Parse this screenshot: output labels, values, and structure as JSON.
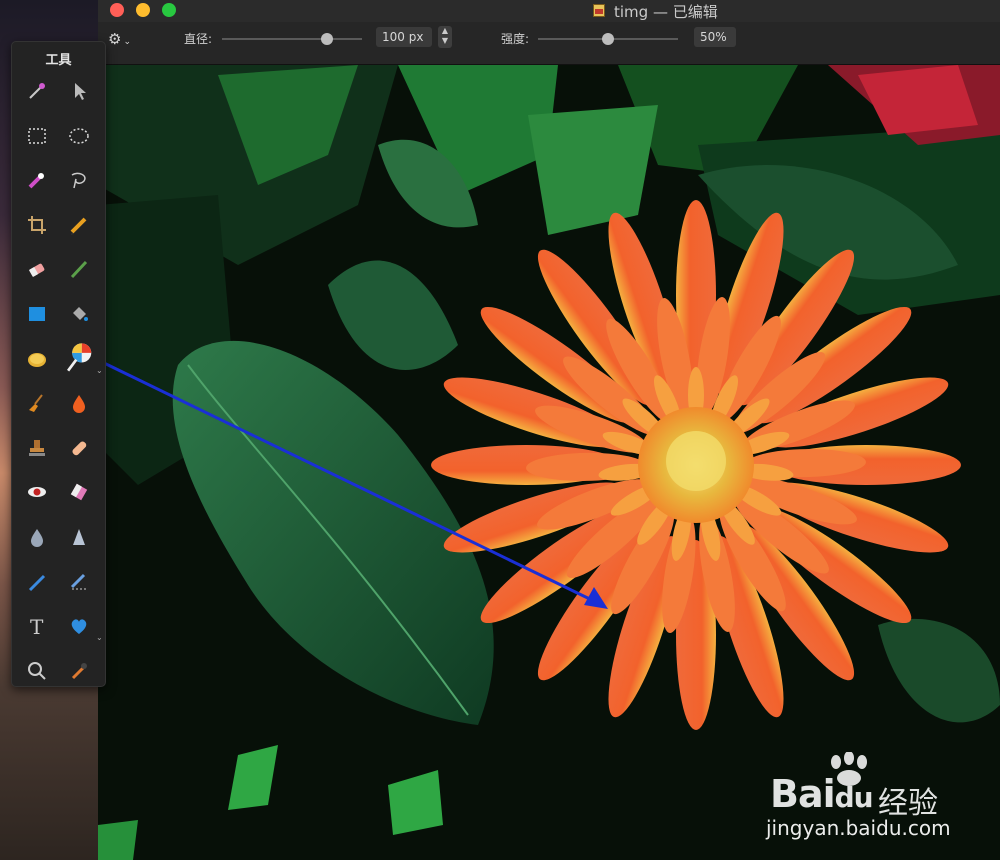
{
  "window": {
    "title": "timg — 已编辑"
  },
  "options_bar": {
    "diameter_label": "直径:",
    "diameter_value": "100 px",
    "diameter_slider_level": 0.75,
    "strength_label": "强度:",
    "strength_value": "50%",
    "strength_slider_level": 0.5
  },
  "palette": {
    "title": "工具",
    "tools": [
      {
        "name": "magic-wand-icon"
      },
      {
        "name": "arrow-pointer-icon"
      },
      {
        "name": "rect-select-icon"
      },
      {
        "name": "ellipse-select-icon"
      },
      {
        "name": "color-select-icon"
      },
      {
        "name": "lasso-icon"
      },
      {
        "name": "crop-icon"
      },
      {
        "name": "pencil-icon"
      },
      {
        "name": "eraser-icon"
      },
      {
        "name": "brush-icon"
      },
      {
        "name": "shape-icon"
      },
      {
        "name": "paint-bucket-icon"
      },
      {
        "name": "coin-icon"
      },
      {
        "name": "lollipop-icon"
      },
      {
        "name": "broom-icon"
      },
      {
        "name": "drop-fire-icon"
      },
      {
        "name": "stamp-icon"
      },
      {
        "name": "bandage-icon"
      },
      {
        "name": "red-eye-icon"
      },
      {
        "name": "gradient-eraser-icon"
      },
      {
        "name": "blur-drop-icon"
      },
      {
        "name": "sharpen-cone-icon"
      },
      {
        "name": "smudge-icon"
      },
      {
        "name": "burn-icon"
      },
      {
        "name": "text-icon"
      },
      {
        "name": "heart-shape-icon"
      },
      {
        "name": "zoom-icon"
      },
      {
        "name": "eyedropper-icon"
      }
    ]
  },
  "text_tool_glyph": "T",
  "watermark": {
    "brand": "Bai",
    "brand2": "du",
    "cn": "经验",
    "url": "jingyan.baidu.com"
  },
  "colors": {
    "arrow": "#1a2fd6",
    "petal": "#f0562a",
    "leaf": "#1f5a36"
  }
}
